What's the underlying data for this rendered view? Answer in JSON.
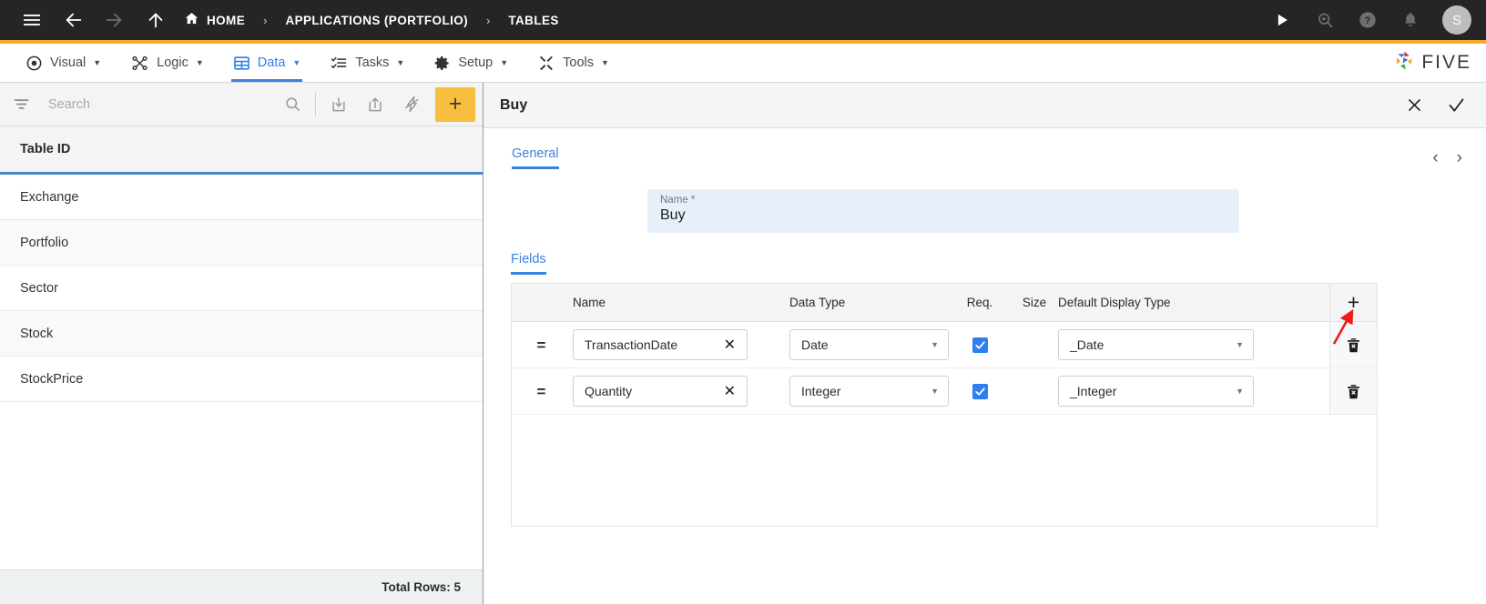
{
  "topbar": {
    "menu_icon": "hamburger-icon",
    "back_icon": "back-arrow-icon",
    "forward_icon": "forward-arrow-icon",
    "up_icon": "up-arrow-icon",
    "breadcrumbs": [
      {
        "label": "HOME",
        "icon": "home-icon"
      },
      {
        "label": "APPLICATIONS (PORTFOLIO)",
        "icon": ""
      },
      {
        "label": "TABLES",
        "icon": ""
      }
    ],
    "separator": "›",
    "actions": [
      {
        "name": "run-icon",
        "title": "Run"
      },
      {
        "name": "search-preview-icon",
        "title": "Search"
      },
      {
        "name": "help-icon",
        "title": "Help"
      },
      {
        "name": "notifications-bell-icon",
        "title": "Notifications"
      }
    ],
    "avatar_initial": "S",
    "accent_color": "#f0ad29",
    "bg_color": "#252525"
  },
  "menubar": {
    "items": [
      {
        "label": "Visual",
        "icon": "eye-icon",
        "caret": "▼",
        "active": false
      },
      {
        "label": "Logic",
        "icon": "logic-nodes-icon",
        "caret": "▼",
        "active": false
      },
      {
        "label": "Data",
        "icon": "grid-table-icon",
        "caret": "▼",
        "active": true
      },
      {
        "label": "Tasks",
        "icon": "task-list-icon",
        "caret": "▼",
        "active": false
      },
      {
        "label": "Setup",
        "icon": "gear-icon",
        "caret": "▼",
        "active": false
      },
      {
        "label": "Tools",
        "icon": "tools-wrench-icon",
        "caret": "▼",
        "active": false
      }
    ],
    "logo_text": "FIVE",
    "active_color": "#2d7ff0"
  },
  "sidebar": {
    "search": {
      "placeholder": "Search",
      "value": ""
    },
    "toolbar": [
      {
        "name": "filter-icon"
      },
      {
        "name": "search-icon"
      },
      {
        "name": "import-icon"
      },
      {
        "name": "export-icon"
      },
      {
        "name": "lightning-icon"
      },
      {
        "name": "add-button",
        "label": "+"
      }
    ],
    "column_header": "Table ID",
    "rows": [
      {
        "name": "Exchange"
      },
      {
        "name": "Portfolio"
      },
      {
        "name": "Sector"
      },
      {
        "name": "Stock"
      },
      {
        "name": "StockPrice"
      }
    ],
    "footer": "Total Rows: 5",
    "add_button_color": "#f8bf3e",
    "header_underline_color": "#4a86c8"
  },
  "detail": {
    "title": "Buy",
    "close_label": "✕",
    "confirm_label": "✓",
    "tabs": [
      {
        "label": "General",
        "active": true
      }
    ],
    "pager": {
      "prev": "‹",
      "next": "›"
    },
    "name_field": {
      "label": "Name *",
      "value": "Buy"
    },
    "fields_tab": "Fields",
    "grid": {
      "columns": [
        "",
        "Name",
        "Data Type",
        "Req.",
        "Size",
        "Default Display Type",
        ""
      ],
      "add_row_label": "+",
      "rows": [
        {
          "handle": "=",
          "name": "TransactionDate",
          "clear": "✕",
          "data_type": "Date",
          "required": true,
          "size": "",
          "default_display_type": "_Date",
          "delete_icon": "delete-row-icon"
        },
        {
          "handle": "=",
          "name": "Quantity",
          "clear": "✕",
          "data_type": "Integer",
          "required": true,
          "size": "",
          "default_display_type": "_Integer",
          "delete_icon": "delete-row-icon"
        }
      ]
    },
    "annotation": {
      "type": "red-arrow",
      "color": "#ee1c1c",
      "points_to": "add-field-button"
    }
  }
}
